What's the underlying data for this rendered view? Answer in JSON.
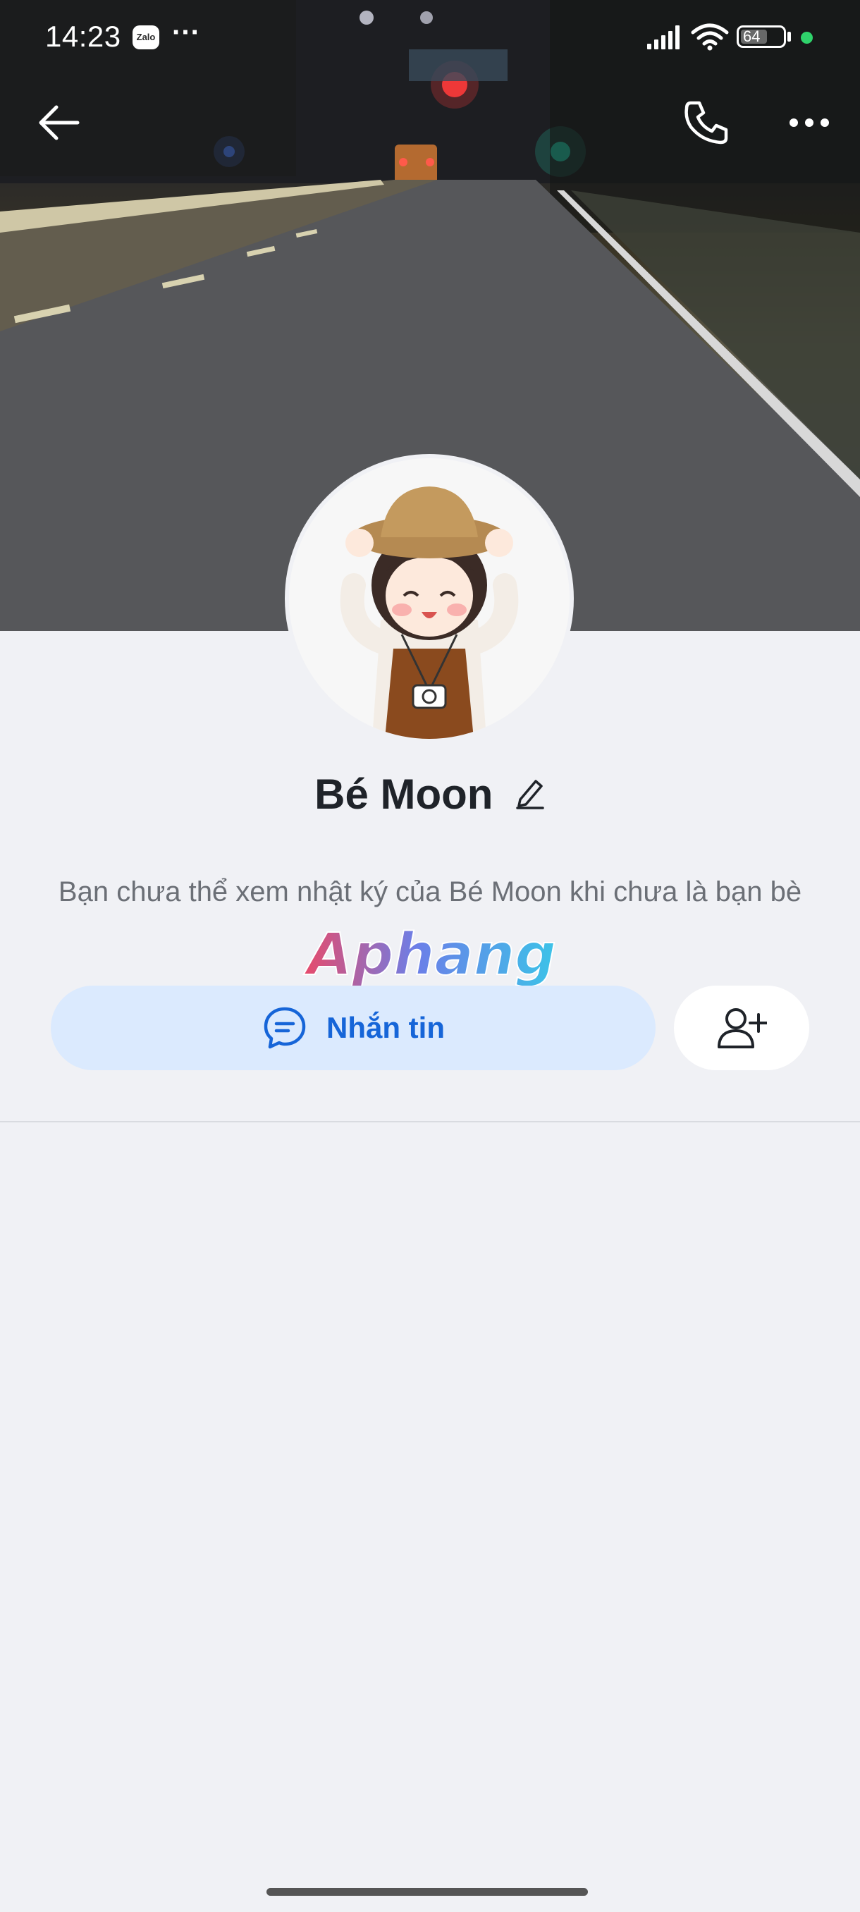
{
  "status_bar": {
    "time": "14:23",
    "app_badge": "Zalo",
    "more": "···",
    "battery": "64",
    "battery_level": 0.64
  },
  "profile": {
    "name": "Bé Moon",
    "note": "Bạn chưa thể xem nhật ký của Bé Moon khi chưa là bạn bè"
  },
  "actions": {
    "message_label": "Nhắn tin"
  },
  "watermark": "Aphang",
  "colors": {
    "accent": "#1665d8",
    "message_bg": "#dbeafe",
    "page_bg": "#f0f1f5",
    "online": "#2fd36b"
  },
  "icons": [
    "back-arrow-icon",
    "phone-icon",
    "more-icon",
    "edit-pencil-icon",
    "chat-bubble-icon",
    "add-friend-icon"
  ]
}
